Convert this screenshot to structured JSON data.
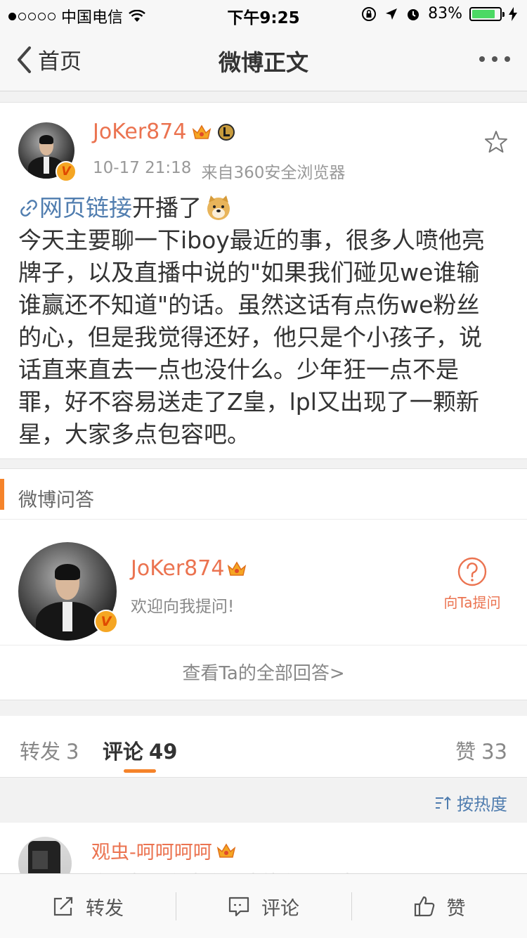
{
  "status_bar": {
    "carrier": "中国电信",
    "time": "下午9:25",
    "battery": "83%",
    "battery_level": 0.83
  },
  "nav": {
    "back_label": "首页",
    "title": "微博正文"
  },
  "post": {
    "author": "JoKer874",
    "time": "10-17 21:18",
    "source": "来自360安全浏览器",
    "link_text": "网页链接",
    "line1_rest": "开播了",
    "lines": [
      "今天主要聊一下iboy最近的事，很多人喷他亮",
      "牌子，以及直播中说的\"如果我们碰见we谁输",
      "谁赢还不知道\"的话。虽然这话有点伤we粉丝",
      "的心，但是我觉得还好，他只是个小孩子，说",
      "话直来直去一点也没什么。少年狂一点不是",
      "罪，好不容易送走了Z皇，lpl又出现了一颗新",
      "星，大家多点包容吧。"
    ]
  },
  "qa": {
    "section_title": "微博问答",
    "name": "JoKer874",
    "welcome": "欢迎向我提问!",
    "ask_label": "向Ta提问",
    "view_all": "查看Ta的全部回答>"
  },
  "tabs": {
    "repost_label": "转发",
    "repost_count": "3",
    "comment_label": "评论",
    "comment_count": "49",
    "like_label": "赞",
    "like_count": "33",
    "sort_label": "按热度"
  },
  "comment": {
    "name": "观虫-呵呵呵呵",
    "text": "真没想到有生竟网也能有人说出一代还只是"
  },
  "toolbar": {
    "repost": "转发",
    "comment": "评论",
    "like": "赞"
  },
  "colors": {
    "accent": "#eb7350",
    "link": "#507daf",
    "orange": "#f5832a"
  }
}
